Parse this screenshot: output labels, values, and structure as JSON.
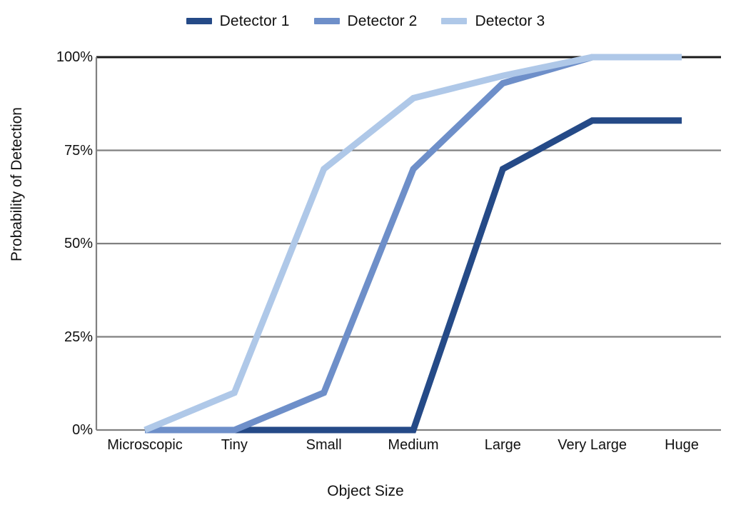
{
  "chart_data": {
    "type": "line",
    "title": "",
    "xlabel": "Object Size",
    "ylabel": "Probability of Detection",
    "categories": [
      "Microscopic",
      "Tiny",
      "Small",
      "Medium",
      "Large",
      "Very Large",
      "Huge"
    ],
    "series": [
      {
        "name": "Detector 1",
        "color": "#254A87",
        "values": [
          0,
          0,
          0,
          0,
          70,
          83,
          83
        ]
      },
      {
        "name": "Detector 2",
        "color": "#6E8FC9",
        "values": [
          0,
          0,
          10,
          70,
          93,
          100,
          100
        ]
      },
      {
        "name": "Detector 3",
        "color": "#AFC8E8",
        "values": [
          0,
          10,
          70,
          89,
          95,
          100,
          100
        ]
      }
    ],
    "ylim": [
      0,
      100
    ],
    "y_ticks": [
      0,
      25,
      50,
      75,
      100
    ],
    "y_tick_labels": [
      "0%",
      "25%",
      "50%",
      "75%",
      "100%"
    ],
    "grid": true,
    "grid_color": "#808080",
    "axis_color": "#1a1a1a",
    "legend_position": "top-center",
    "value_unit": "%"
  },
  "legend": {
    "items": [
      {
        "label": "Detector 1",
        "color": "#254A87"
      },
      {
        "label": "Detector 2",
        "color": "#6E8FC9"
      },
      {
        "label": "Detector 3",
        "color": "#AFC8E8"
      }
    ]
  },
  "axes": {
    "y_title": "Probability of Detection",
    "x_title": "Object Size"
  }
}
